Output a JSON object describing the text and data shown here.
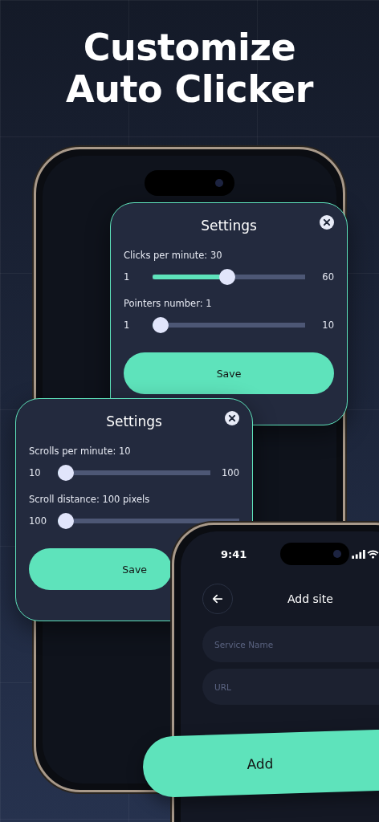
{
  "headline": [
    "Customize",
    "Auto Clicker"
  ],
  "settings_cards": [
    {
      "title": "Settings",
      "sliders": [
        {
          "label": "Clicks per minute: 30",
          "min": "1",
          "max": "60",
          "level": 0.49
        },
        {
          "label": "Pointers number: 1",
          "min": "1",
          "max": "10",
          "level": 0
        }
      ],
      "button": "Save"
    },
    {
      "title": "Settings",
      "sliders": [
        {
          "label": "Scrolls per minute: 10",
          "min": "10",
          "max": "100",
          "level": 0
        },
        {
          "label": "Scroll distance: 100 pixels",
          "min": "100",
          "level": 0
        }
      ],
      "button": "Save"
    }
  ],
  "add_site_screen": {
    "status_time": "9:41",
    "title": "Add site",
    "fields": [
      {
        "placeholder": "Service Name"
      },
      {
        "placeholder": "URL"
      }
    ],
    "button": "Add"
  }
}
